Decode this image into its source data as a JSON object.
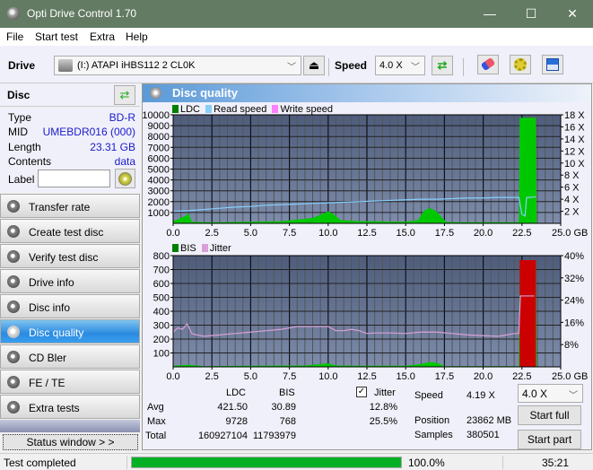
{
  "window": {
    "title": "Opti Drive Control 1.70",
    "minimize": "—",
    "maximize": "☐",
    "close": "✕"
  },
  "menu": [
    "File",
    "Start test",
    "Extra",
    "Help"
  ],
  "toolbar": {
    "drive_label": "Drive",
    "drive_value": "(I:)  ATAPI iHBS112   2 CL0K",
    "speed_label": "Speed",
    "speed_value": "4.0 X",
    "eject_icon": "⏏",
    "refresh_icon": "⇄",
    "erase_icon": "eraser",
    "settings_icon": "gears",
    "save_icon": "floppy"
  },
  "disc": {
    "header": "Disc",
    "fields": [
      {
        "key": "Type",
        "value": "BD-R"
      },
      {
        "key": "MID",
        "value": "UMEBDR016 (000)"
      },
      {
        "key": "Length",
        "value": "23.31 GB"
      },
      {
        "key": "Contents",
        "value": "data"
      }
    ],
    "label_key": "Label",
    "label_value": ""
  },
  "nav": [
    {
      "label": "Transfer rate",
      "active": false
    },
    {
      "label": "Create test disc",
      "active": false
    },
    {
      "label": "Verify test disc",
      "active": false
    },
    {
      "label": "Drive info",
      "active": false
    },
    {
      "label": "Disc info",
      "active": false
    },
    {
      "label": "Disc quality",
      "active": true
    },
    {
      "label": "CD Bler",
      "active": false
    },
    {
      "label": "FE / TE",
      "active": false
    },
    {
      "label": "Extra tests",
      "active": false
    }
  ],
  "status_window_button": "Status window > >",
  "main": {
    "title": "Disc quality",
    "chart1_legend": [
      {
        "label": "LDC",
        "color": "#008000"
      },
      {
        "label": "Read speed",
        "color": "#87cefa"
      },
      {
        "label": "Write speed",
        "color": "#ff80ff"
      }
    ],
    "chart2_legend": [
      {
        "label": "BIS",
        "color": "#008000"
      },
      {
        "label": "Jitter",
        "color": "#d8a0d8"
      }
    ]
  },
  "chart_data": [
    {
      "type": "area",
      "title": "LDC / Read speed",
      "xlabel": "GB",
      "x_ticks": [
        "0.0",
        "2.5",
        "5.0",
        "7.5",
        "10.0",
        "12.5",
        "15.0",
        "17.5",
        "20.0",
        "22.5",
        "25.0 GB"
      ],
      "y_ticks": [
        "10000",
        "9000",
        "8000",
        "7000",
        "6000",
        "5000",
        "4000",
        "3000",
        "2000",
        "1000"
      ],
      "y2_ticks": [
        "18 X",
        "16 X",
        "14 X",
        "12 X",
        "10 X",
        "8 X",
        "6 X",
        "4 X",
        "2 X"
      ],
      "xlim": [
        0,
        25
      ],
      "ylim": [
        0,
        10000
      ],
      "y2lim": [
        0,
        18
      ],
      "grid": true,
      "series": [
        {
          "name": "LDC",
          "color": "#00c800",
          "x": [
            0,
            0.5,
            0.8,
            1.0,
            1.2,
            2,
            3,
            5,
            7,
            8,
            9,
            9.5,
            10,
            10.3,
            10.8,
            11.5,
            12,
            13,
            14,
            15,
            15.8,
            16.2,
            16.6,
            17,
            17.3,
            17.6,
            18,
            20,
            22,
            22.3,
            22.35,
            23.4,
            23.45
          ],
          "y": [
            200,
            500,
            700,
            900,
            150,
            100,
            100,
            150,
            200,
            350,
            500,
            800,
            1100,
            900,
            300,
            250,
            200,
            200,
            150,
            150,
            300,
            1200,
            1400,
            1100,
            600,
            150,
            100,
            100,
            100,
            100,
            9728,
            9728,
            0
          ]
        },
        {
          "name": "Read speed",
          "color": "#87cefa",
          "x": [
            0,
            1,
            2,
            3,
            4,
            5,
            6,
            7,
            8,
            9,
            10,
            11,
            12,
            13,
            14,
            15,
            16,
            17,
            18,
            19,
            20,
            21,
            22,
            22.3,
            22.5,
            22.7,
            22.8,
            23.0,
            23.4
          ],
          "y": [
            2.0,
            2.1,
            2.3,
            2.5,
            2.7,
            2.8,
            3.0,
            3.1,
            3.2,
            3.3,
            3.4,
            3.5,
            3.6,
            3.7,
            3.8,
            3.9,
            4.0,
            4.0,
            4.1,
            4.2,
            4.2,
            4.3,
            4.3,
            4.3,
            1.5,
            1.2,
            4.3,
            4.3,
            4.4
          ]
        }
      ]
    },
    {
      "type": "area",
      "title": "BIS / Jitter",
      "xlabel": "GB",
      "x_ticks": [
        "0.0",
        "2.5",
        "5.0",
        "7.5",
        "10.0",
        "12.5",
        "15.0",
        "17.5",
        "20.0",
        "22.5",
        "25.0 GB"
      ],
      "y_ticks": [
        "800",
        "700",
        "600",
        "500",
        "400",
        "300",
        "200",
        "100"
      ],
      "y2_ticks": [
        "40%",
        "32%",
        "24%",
        "16%",
        "8%"
      ],
      "xlim": [
        0,
        25
      ],
      "ylim": [
        0,
        800
      ],
      "y2lim": [
        0,
        40
      ],
      "grid": true,
      "series": [
        {
          "name": "BIS",
          "color": "#00c800",
          "x": [
            0,
            1,
            2,
            5,
            8.5,
            9.5,
            10,
            10.5,
            12,
            15,
            16,
            16.5,
            17,
            17.5,
            22.2,
            22.3,
            22.35,
            23.4,
            23.45
          ],
          "y": [
            8,
            15,
            5,
            8,
            10,
            20,
            25,
            10,
            8,
            8,
            20,
            35,
            30,
            5,
            5,
            5,
            768,
            768,
            0
          ]
        },
        {
          "name": "Jitter",
          "color": "#d8a0d8",
          "x": [
            0,
            0.3,
            0.6,
            0.9,
            1.2,
            1.5,
            2,
            3,
            4,
            5,
            6,
            7,
            8,
            9,
            10,
            10.5,
            11,
            11.5,
            12,
            12.5,
            13,
            14,
            15,
            16,
            17,
            18,
            19,
            20,
            21,
            21.5,
            22,
            22.3,
            22.35,
            22.4,
            23.3
          ],
          "y": [
            12.5,
            14,
            13.5,
            15.5,
            12,
            11.5,
            11,
            11.5,
            12,
            12.5,
            13,
            13.5,
            14.5,
            14.5,
            14.5,
            13,
            13,
            13.5,
            13,
            12,
            12.2,
            12.2,
            12,
            12.5,
            12.5,
            12,
            11.5,
            11.2,
            11,
            11.5,
            12,
            12,
            19,
            25.5,
            25.5
          ]
        }
      ]
    }
  ],
  "stats": {
    "col_ldc": "LDC",
    "col_bis": "BIS",
    "jitter_label": "Jitter",
    "jitter_checked": true,
    "rows": [
      {
        "label": "Avg",
        "ldc": "421.50",
        "bis": "30.89",
        "jitter": "12.8%"
      },
      {
        "label": "Max",
        "ldc": "9728",
        "bis": "768",
        "jitter": "25.5%"
      },
      {
        "label": "Total",
        "ldc": "160927104",
        "bis": "11793979",
        "jitter": ""
      }
    ],
    "speed_label": "Speed",
    "speed_value": "4.19 X",
    "position_label": "Position",
    "position_value": "23862 MB",
    "samples_label": "Samples",
    "samples_value": "380501",
    "speed_select": "4.0 X",
    "start_full": "Start full",
    "start_part": "Start part"
  },
  "statusbar": {
    "text": "Test completed",
    "progress": 1.0,
    "progress_text": "100.0%",
    "time": "35:21"
  }
}
